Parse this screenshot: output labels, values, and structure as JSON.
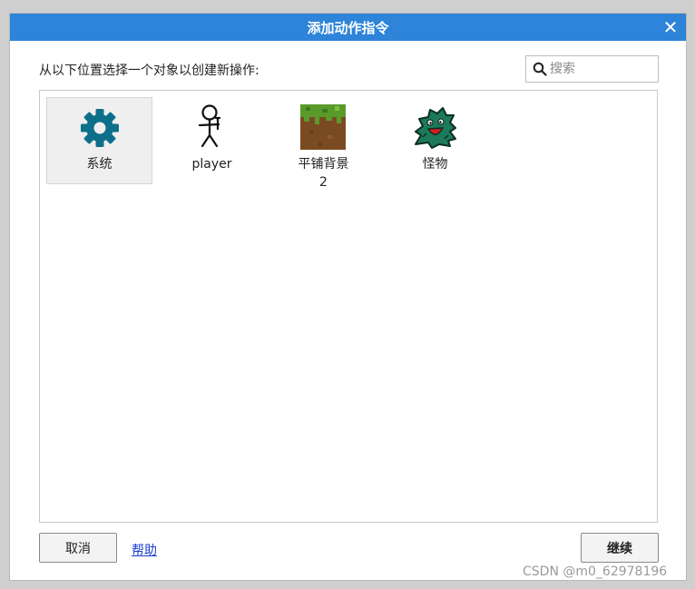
{
  "dialog": {
    "title": "添加动作指令",
    "close_glyph": "✕",
    "prompt": "从以下位置选择一个对象以创建新操作:",
    "search": {
      "placeholder": "搜索",
      "value": ""
    },
    "objects": [
      {
        "label": "系统",
        "icon": "gear-icon",
        "selected": true
      },
      {
        "label": "player",
        "icon": "stick-figure-icon",
        "selected": false
      },
      {
        "label": "平铺背景\n2",
        "icon": "tiled-background-icon",
        "selected": false
      },
      {
        "label": "怪物",
        "icon": "monster-icon",
        "selected": false
      }
    ],
    "buttons": {
      "cancel": "取消",
      "help": "帮助",
      "continue": "继续"
    }
  },
  "watermark": "CSDN @m0_62978196",
  "colors": {
    "titlebar": "#2d84d8",
    "gear": "#0e6f8a",
    "grass": "#5a9a2a",
    "dirt": "#7a4a22",
    "monster": "#1c7a5a"
  }
}
